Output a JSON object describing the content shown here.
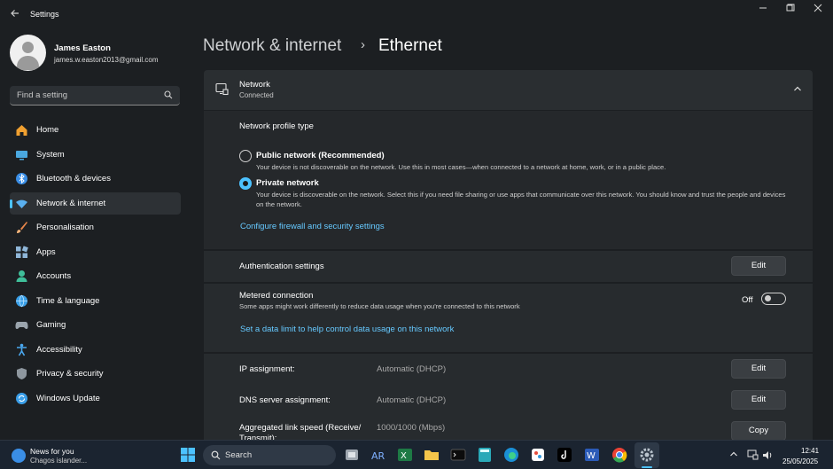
{
  "window": {
    "title": "Settings",
    "back_icon": "back-arrow-icon",
    "controls": [
      "minimize-icon",
      "maximize-icon",
      "close-icon"
    ]
  },
  "profile": {
    "name": "James Easton",
    "email": "james.w.easton2013@gmail.com"
  },
  "search": {
    "placeholder": "Find a setting"
  },
  "nav": {
    "items": [
      {
        "label": "Home",
        "icon": "home-icon",
        "color": "#f0a030"
      },
      {
        "label": "System",
        "icon": "system-icon",
        "color": "#4aa8e0"
      },
      {
        "label": "Bluetooth & devices",
        "icon": "bluetooth-icon",
        "color": "#3a8ee6"
      },
      {
        "label": "Network & internet",
        "icon": "wifi-icon",
        "color": "#5ab0ef",
        "active": true
      },
      {
        "label": "Personalisation",
        "icon": "brush-icon",
        "color": "#e8864a"
      },
      {
        "label": "Apps",
        "icon": "apps-icon",
        "color": "#8fb6d8"
      },
      {
        "label": "Accounts",
        "icon": "accounts-icon",
        "color": "#3fbf9a"
      },
      {
        "label": "Time & language",
        "icon": "globe-icon",
        "color": "#3aa0e8"
      },
      {
        "label": "Gaming",
        "icon": "gamepad-icon",
        "color": "#9aa4ad"
      },
      {
        "label": "Accessibility",
        "icon": "accessibility-icon",
        "color": "#4aa8f0"
      },
      {
        "label": "Privacy & security",
        "icon": "shield-icon",
        "color": "#8e979f"
      },
      {
        "label": "Windows Update",
        "icon": "update-icon",
        "color": "#3a9ee8"
      }
    ]
  },
  "header": {
    "parent": "Network & internet",
    "separator": "›",
    "current": "Ethernet"
  },
  "network": {
    "title": "Network",
    "status": "Connected",
    "profile_type_label": "Network profile type",
    "public_title": "Public network (Recommended)",
    "public_desc": "Your device is not discoverable on the network. Use this in most cases—when connected to a network at home, work, or in a public place.",
    "public_selected": false,
    "private_title": "Private network",
    "private_desc": "Your device is discoverable on the network. Select this if you need file sharing or use apps that communicate over this network. You should know and trust the people and devices on the network.",
    "private_selected": true,
    "firewall_link": "Configure firewall and security settings"
  },
  "auth": {
    "label": "Authentication settings",
    "button": "Edit"
  },
  "metered": {
    "label": "Metered connection",
    "desc": "Some apps might work differently to reduce data usage when you're connected to this network",
    "toggle_state": "Off",
    "limit_link": "Set a data limit to help control data usage on this network"
  },
  "ip": {
    "rows": [
      {
        "label": "IP assignment:",
        "value": "Automatic (DHCP)",
        "button": "Edit"
      },
      {
        "label": "DNS server assignment:",
        "value": "Automatic (DHCP)",
        "button": "Edit"
      },
      {
        "label": "Aggregated link speed (Receive/ Transmit):",
        "value": "1000/1000 (Mbps)",
        "button": "Copy"
      }
    ]
  },
  "taskbar": {
    "news_title": "News for you",
    "news_sub": "Chagos islander...",
    "search_label": "Search",
    "time": "12:41",
    "date": "25/05/2025",
    "apps": [
      "start-icon",
      "file-explorer-icon",
      "ar-app-icon",
      "excel-icon",
      "folder-icon",
      "terminal-icon",
      "calculator-icon",
      "edge-icon",
      "paint-icon",
      "tiktok-icon",
      "word-icon",
      "chrome-icon",
      "settings-icon"
    ]
  }
}
